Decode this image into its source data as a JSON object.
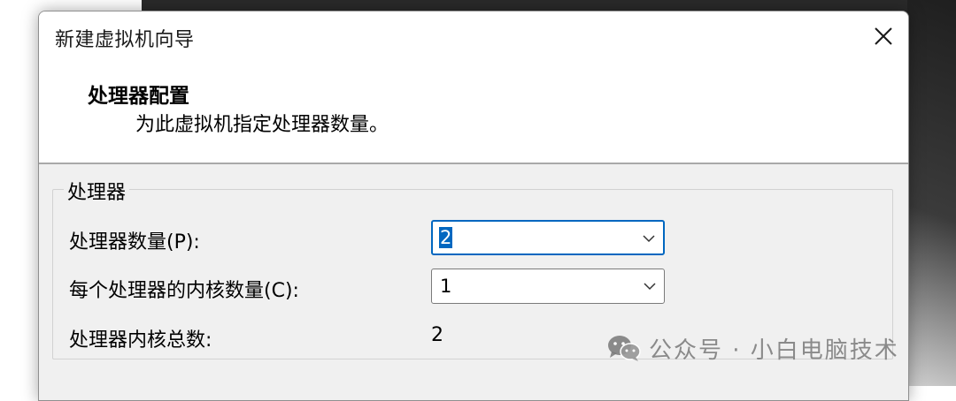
{
  "window": {
    "title": "新建虚拟机向导"
  },
  "header": {
    "title": "处理器配置",
    "subtitle": "为此虚拟机指定处理器数量。"
  },
  "processor_group": {
    "legend": "处理器",
    "count_label": "处理器数量(P):",
    "count_value": "2",
    "cores_label": "每个处理器的内核数量(C):",
    "cores_value": "1",
    "total_label": "处理器内核总数:",
    "total_value": "2"
  },
  "watermark": {
    "text": "公众号 · 小白电脑技术"
  },
  "colors": {
    "accent": "#0067c0",
    "dialog_bg": "#f0f0f0"
  }
}
